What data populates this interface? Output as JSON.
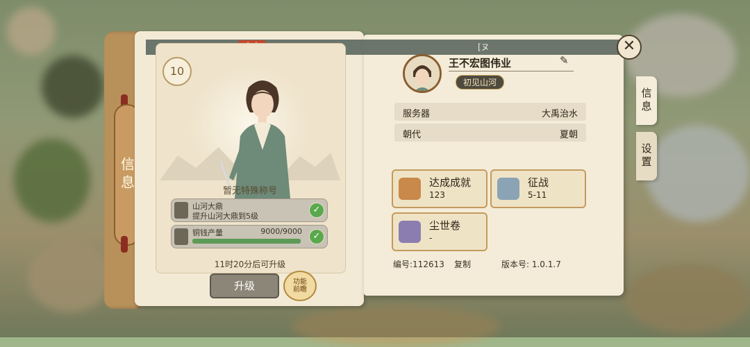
{
  "top_ribbon": {
    "tag": "官方",
    "mark": "[ヌ"
  },
  "left_tab": {
    "label": "信息"
  },
  "character": {
    "level": "10",
    "title": "暂无特殊称号",
    "tasks": [
      {
        "name": "山河大鼎",
        "desc": "提升山河大鼎到5级",
        "completed": true
      },
      {
        "name": "铜钱产量",
        "value": "9000/9000",
        "progress": 1.0,
        "completed": true
      }
    ],
    "timer": "11时20分后可升级",
    "upgrade_label": "升级",
    "preview_label": "功能前瞻"
  },
  "player": {
    "name": "王不宏图伟业",
    "badge": "初见山河",
    "info": [
      {
        "key": "服务器",
        "value": "大禹治水"
      },
      {
        "key": "朝代",
        "value": "夏朝"
      }
    ],
    "stats": [
      {
        "label": "达成成就",
        "value": "123",
        "icon": "phoenix-emblem-icon",
        "color": "#c9894a"
      },
      {
        "label": "征战",
        "value": "5-11",
        "icon": "crossed-swords-icon",
        "color": "#8aa3b5"
      },
      {
        "label": "尘世卷",
        "value": "-",
        "icon": "snowflake-emblem-icon",
        "color": "#8c7db1"
      }
    ],
    "id_text": "编号:112613",
    "copy_label": "复制",
    "version_text": "版本号: 1.0.1.7"
  },
  "side_tabs": [
    {
      "label": "信息",
      "active": true
    },
    {
      "label": "设置",
      "active": false
    }
  ],
  "close_icon": "close-icon"
}
